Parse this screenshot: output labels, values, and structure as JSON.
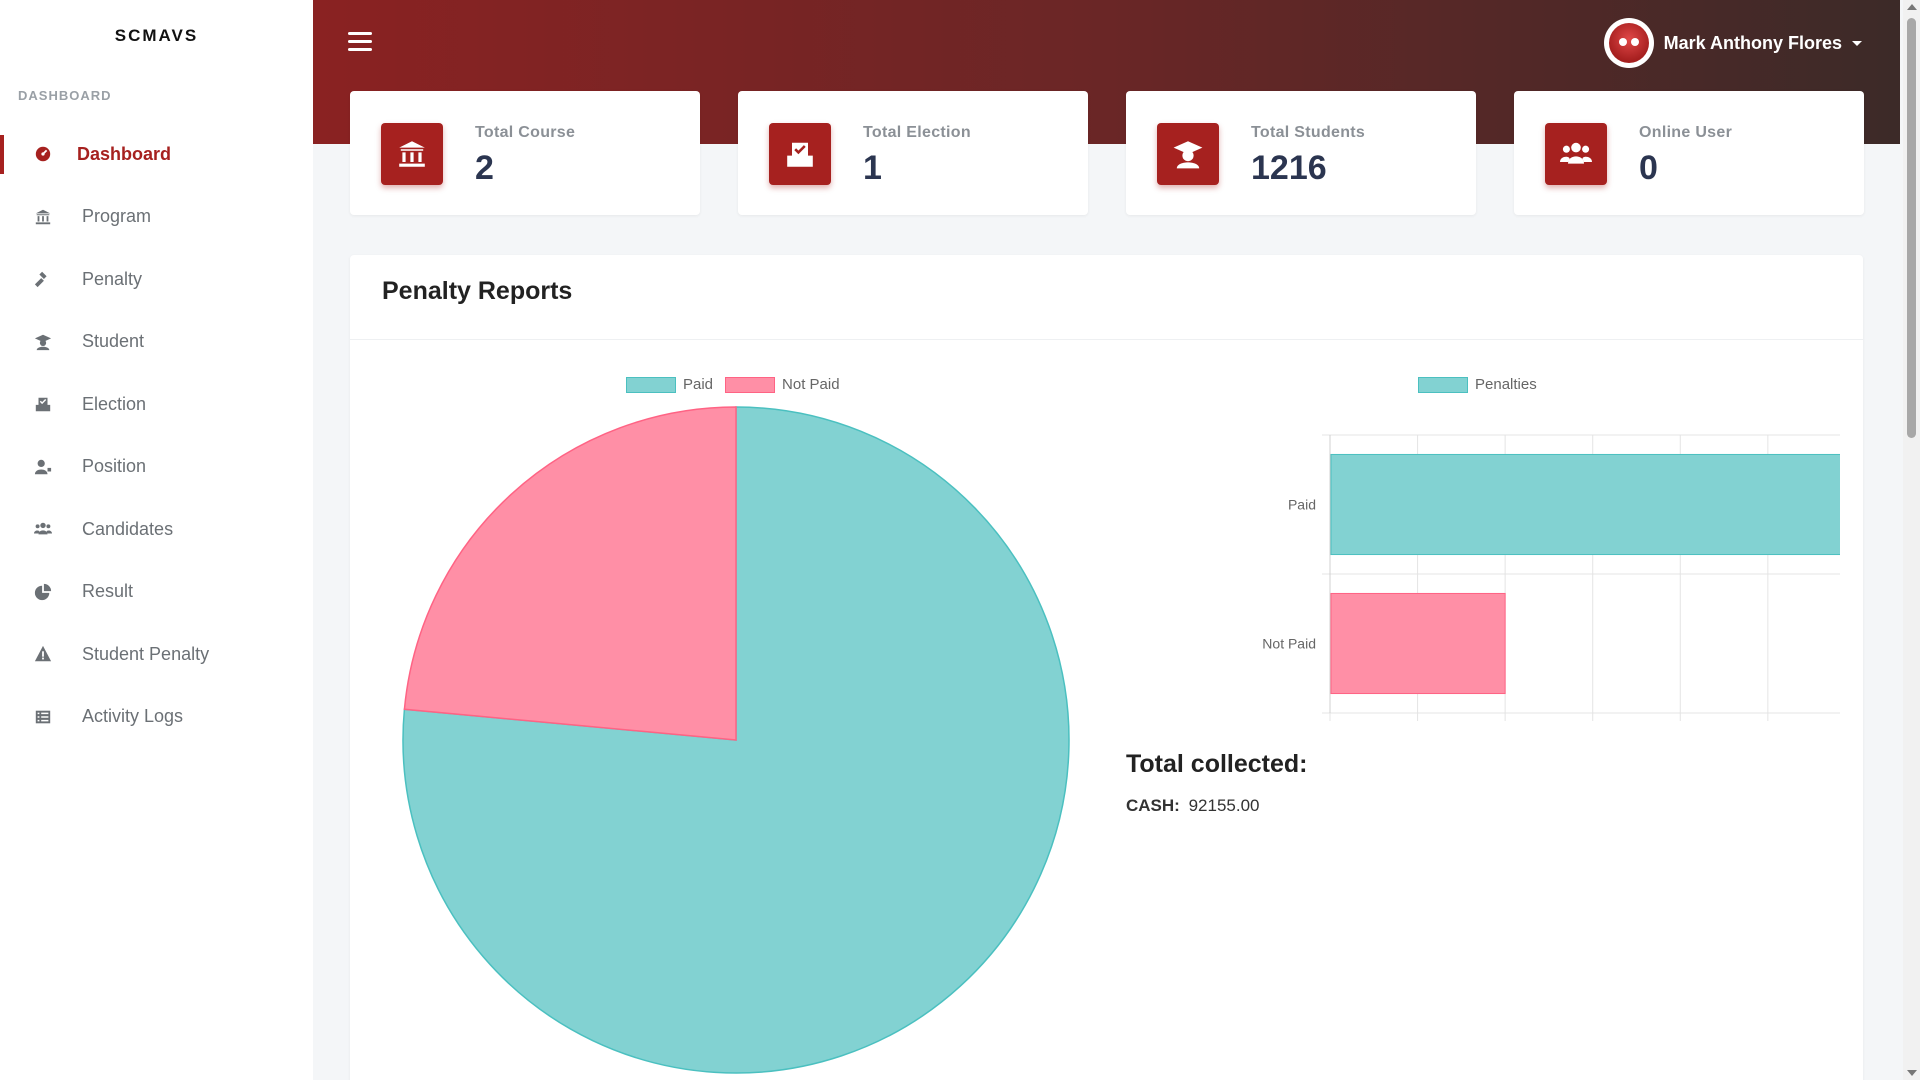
{
  "sidebar": {
    "brand": "SCMAVS",
    "section_label": "DASHBOARD",
    "items": [
      {
        "label": "Dashboard",
        "icon": "tachometer-icon",
        "active": true
      },
      {
        "label": "Program",
        "icon": "university-icon"
      },
      {
        "label": "Penalty",
        "icon": "gavel-icon"
      },
      {
        "label": "Student",
        "icon": "graduate-icon"
      },
      {
        "label": "Election",
        "icon": "vote-box-icon"
      },
      {
        "label": "Position",
        "icon": "user-tie-icon"
      },
      {
        "label": "Candidates",
        "icon": "users-icon"
      },
      {
        "label": "Result",
        "icon": "pie-chart-icon"
      },
      {
        "label": "Student Penalty",
        "icon": "warning-icon"
      },
      {
        "label": "Activity Logs",
        "icon": "list-icon"
      }
    ]
  },
  "header": {
    "user_name": "Mark Anthony Flores"
  },
  "stats": [
    {
      "label": "Total Course",
      "value": "2",
      "icon": "university-icon"
    },
    {
      "label": "Total Election",
      "value": "1",
      "icon": "vote-box-icon"
    },
    {
      "label": "Total Students",
      "value": "1216",
      "icon": "graduate-icon"
    },
    {
      "label": "Online User",
      "value": "0",
      "icon": "users-icon"
    }
  ],
  "report": {
    "title": "Penalty Reports",
    "total_title": "Total collected:",
    "cash_label": "CASH:",
    "cash_value": "92155.00"
  },
  "colors": {
    "accent": "#a6211f",
    "teal": "#82d2d2",
    "teal_border": "#4bc0c0",
    "pink": "#ff8fa6",
    "pink_border": "#ff6384"
  },
  "chart_data": [
    {
      "type": "pie",
      "categories": [
        "Paid",
        "Not Paid"
      ],
      "values": [
        650,
        200
      ],
      "legend_position": "top"
    },
    {
      "type": "bar",
      "orientation": "horizontal",
      "categories": [
        "Paid",
        "Not Paid"
      ],
      "series": [
        {
          "name": "Penalties",
          "values": [
            650,
            200
          ]
        }
      ],
      "xlim": [
        0,
        700
      ],
      "xticks": [
        0,
        100,
        200,
        300,
        400,
        500,
        600,
        700
      ],
      "grid": true,
      "legend_position": "top"
    }
  ]
}
